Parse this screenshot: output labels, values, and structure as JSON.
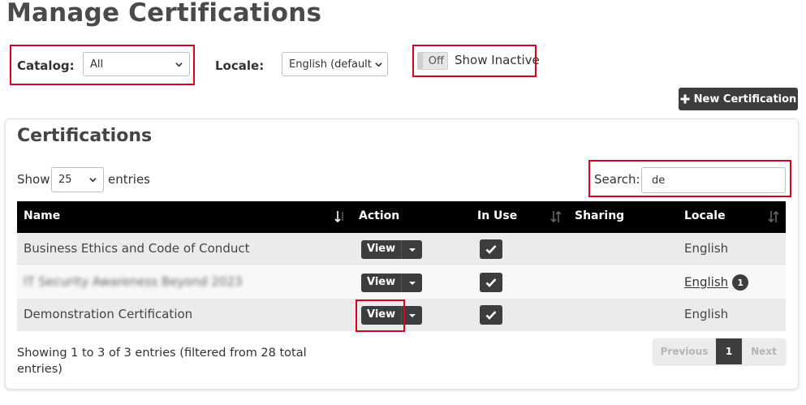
{
  "page": {
    "title": "Manage Certifications"
  },
  "filters": {
    "catalog_label": "Catalog:",
    "catalog_value": "All",
    "locale_label": "Locale:",
    "locale_value": "English (default",
    "toggle_state": "Off",
    "toggle_label": "Show Inactive"
  },
  "toolbar": {
    "new_label": "New Certification",
    "new_icon": "plus-icon"
  },
  "card": {
    "title": "Certifications",
    "show_label": "Show",
    "entries_value": "25",
    "entries_label": "entries",
    "search_label": "Search:",
    "search_value": "de"
  },
  "table": {
    "columns": [
      "Name",
      "Action",
      "In Use",
      "Sharing",
      "Locale"
    ],
    "rows": [
      {
        "name": "Business Ethics and Code of Conduct",
        "action": "View",
        "in_use": true,
        "sharing": "",
        "locale": "English",
        "locale_link": false,
        "badge": ""
      },
      {
        "name": "IT Security Awareness Beyond 2023",
        "action": "View",
        "in_use": true,
        "sharing": "",
        "locale": "English",
        "locale_link": true,
        "badge": "1",
        "name_blurred": true
      },
      {
        "name": "Demonstration Certification",
        "action": "View",
        "in_use": true,
        "sharing": "",
        "locale": "English",
        "locale_link": false,
        "badge": ""
      }
    ]
  },
  "footer": {
    "info": "Showing 1 to 3 of 3 entries (filtered from 28 total entries)",
    "prev_label": "Previous",
    "current_page": "1",
    "next_label": "Next"
  },
  "colors": {
    "highlight": "#e0001b",
    "header_bg": "#000000",
    "dark_button": "#3d3d3d"
  }
}
